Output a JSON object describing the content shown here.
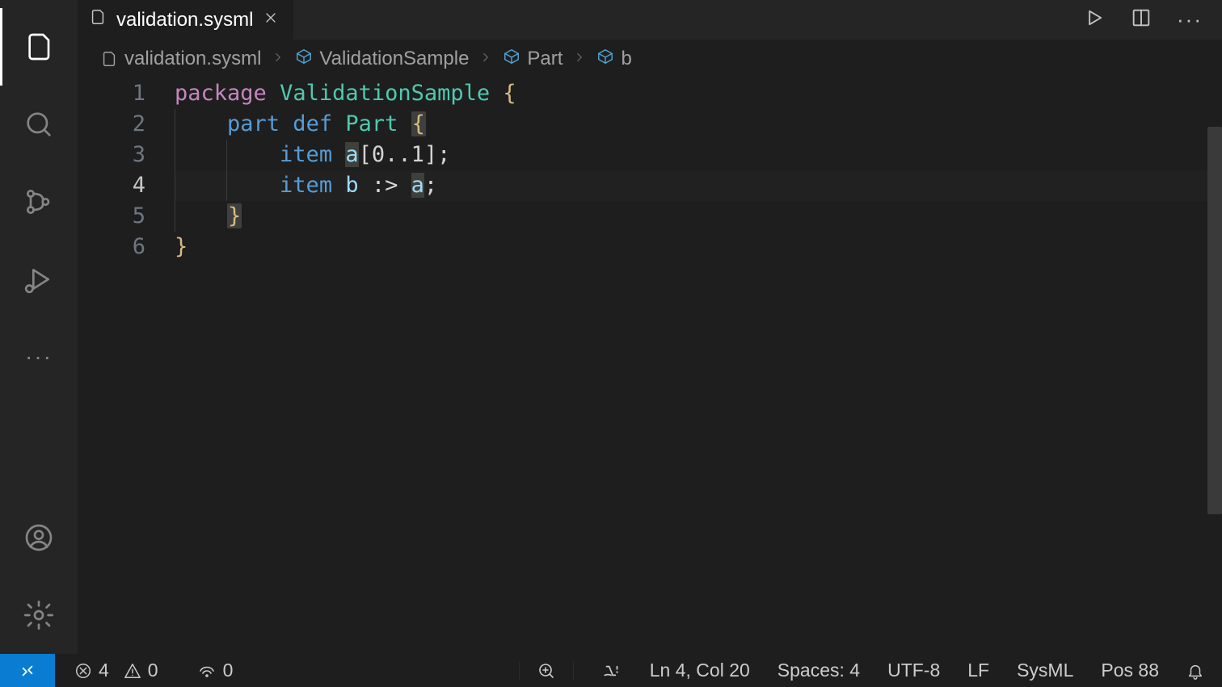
{
  "tab": {
    "filename": "validation.sysml"
  },
  "breadcrumb": {
    "file": "validation.sysml",
    "seg1": "ValidationSample",
    "seg2": "Part",
    "seg3": "b"
  },
  "code": {
    "lines": [
      {
        "n": "1"
      },
      {
        "n": "2"
      },
      {
        "n": "3"
      },
      {
        "n": "4"
      },
      {
        "n": "5"
      },
      {
        "n": "6"
      }
    ],
    "l1": {
      "kw": "package",
      "name": "ValidationSample",
      "br": "{"
    },
    "l2": {
      "kw": "part def",
      "name": "Part",
      "br": "{"
    },
    "l3": {
      "kw": "item",
      "var": "a",
      "range": "[0..1]",
      "semi": ";"
    },
    "l4": {
      "kw": "item",
      "var": "b",
      "op": ":>",
      "ref": "a",
      "semi": ";"
    },
    "l5": {
      "br": "}"
    },
    "l6": {
      "br": "}"
    }
  },
  "status": {
    "errors": "4",
    "warnings": "0",
    "ports": "0",
    "ln_col": "Ln 4, Col 20",
    "spaces": "Spaces: 4",
    "encoding": "UTF-8",
    "eol": "LF",
    "lang": "SysML",
    "pos": "Pos 88"
  }
}
